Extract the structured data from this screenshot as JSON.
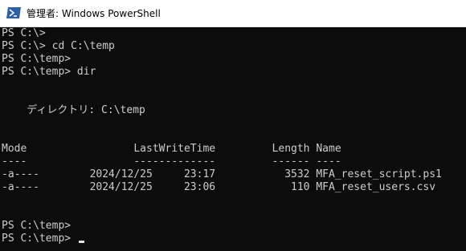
{
  "window": {
    "title": "管理者: Windows PowerShell",
    "icon": "powershell-icon"
  },
  "colors": {
    "console_bg": "#0c0c0c",
    "console_fg": "#cccccc",
    "titlebar_bg": "#ffffff",
    "icon_blue": "#2d5fa8"
  },
  "console": {
    "lines": [
      "PS C:\\>",
      "PS C:\\> cd C:\\temp",
      "PS C:\\temp>",
      "PS C:\\temp> dir",
      "",
      "",
      "    ディレクトリ: C:\\temp",
      "",
      "",
      "Mode                 LastWriteTime         Length Name",
      "----                 -------------         ------ ----",
      "-a----        2024/12/25     23:17           3532 MFA_reset_script.ps1",
      "-a----        2024/12/25     23:06            110 MFA_reset_users.csv",
      "",
      "",
      "PS C:\\temp>",
      "PS C:\\temp> "
    ]
  }
}
